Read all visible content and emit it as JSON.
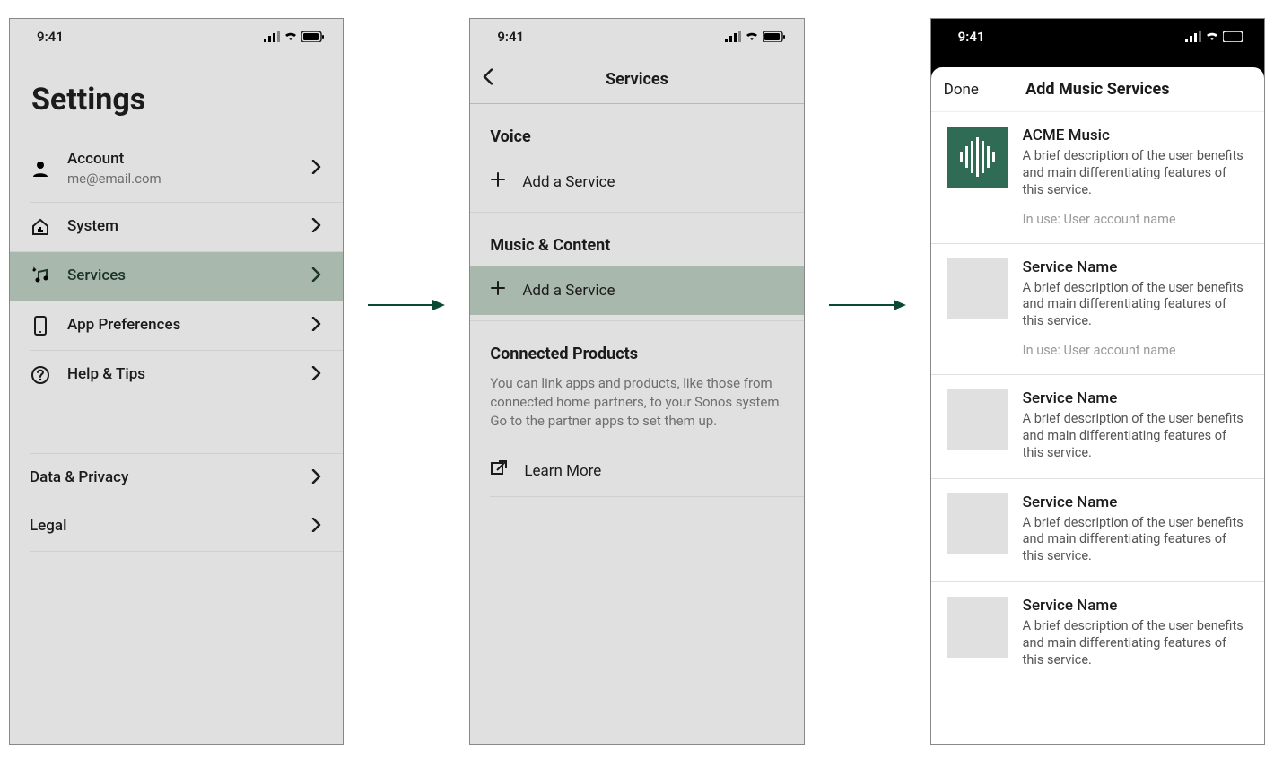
{
  "statusbar": {
    "time": "9:41"
  },
  "screen1": {
    "title": "Settings",
    "rows": [
      {
        "icon": "user",
        "label": "Account",
        "sub": "me@email.com"
      },
      {
        "icon": "house",
        "label": "System"
      },
      {
        "icon": "music",
        "label": "Services",
        "selected": true
      },
      {
        "icon": "phone",
        "label": "App Preferences"
      },
      {
        "icon": "help",
        "label": "Help & Tips"
      }
    ],
    "bottomRows": [
      {
        "label": "Data & Privacy"
      },
      {
        "label": "Legal"
      }
    ]
  },
  "screen2": {
    "navTitle": "Services",
    "sections": [
      {
        "title": "Voice",
        "actionLabel": "Add a Service"
      },
      {
        "title": "Music & Content",
        "actionLabel": "Add a Service",
        "selected": true
      },
      {
        "title": "Connected Products",
        "desc": "You can link apps and products, like those from connected home partners, to your Sonos system. Go to the partner apps to set them up.",
        "actionLabel": "Learn More",
        "icon": "external"
      }
    ]
  },
  "screen3": {
    "doneLabel": "Done",
    "title": "Add Music Services",
    "services": [
      {
        "name": "ACME Music",
        "desc": "A brief description of the user benefits and main differentiating features of this service.",
        "inUse": "In use: User account name",
        "icon": "acme"
      },
      {
        "name": "Service Name",
        "desc": "A brief description of the user benefits and main differentiating features of this service.",
        "inUse": "In use: User account name"
      },
      {
        "name": "Service Name",
        "desc": "A brief description of the user benefits and main differentiating features of this service."
      },
      {
        "name": "Service Name",
        "desc": "A brief description of the user benefits and main differentiating features of this service."
      },
      {
        "name": "Service Name",
        "desc": "A brief description of the user benefits and main differentiating features of this service."
      }
    ]
  }
}
